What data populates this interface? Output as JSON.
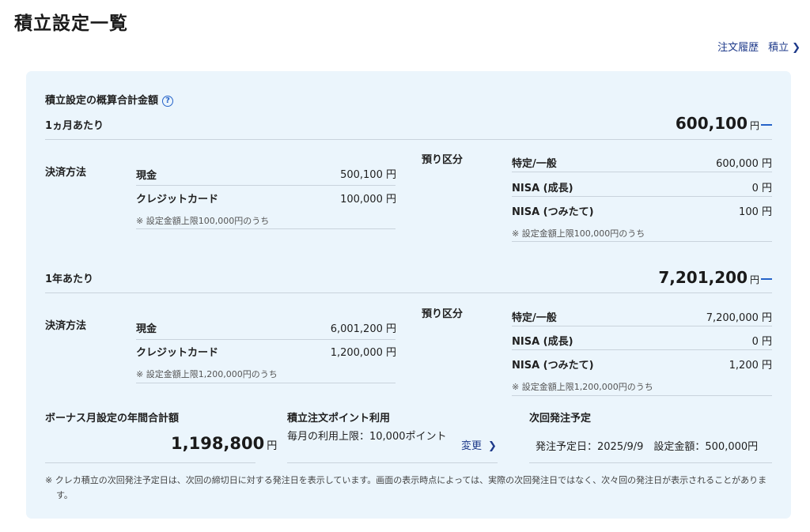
{
  "page": {
    "title": "積立設定一覧",
    "links": {
      "history": "注文履歴",
      "tsumitate": "積立"
    }
  },
  "summary": {
    "title": "積立設定の概算合計金額",
    "help_icon": "?"
  },
  "month": {
    "label": "1ヵ月あたり",
    "total": "600,100",
    "unit": "円",
    "payment_label": "決済方法",
    "cash_label": "現金",
    "cash_value": "500,100 円",
    "credit_label": "クレジットカード",
    "credit_value": "100,000 円",
    "credit_note": "※ 設定金額上限100,000円のうち",
    "account_label": "預り区分",
    "general_label": "特定/一般",
    "general_value": "600,000 円",
    "nisa_growth_label": "NISA (成長)",
    "nisa_growth_value": "0 円",
    "nisa_tsumi_label": "NISA (つみたて)",
    "nisa_tsumi_value": "100 円",
    "nisa_note": "※ 設定金額上限100,000円のうち"
  },
  "year": {
    "label": "1年あたり",
    "total": "7,201,200",
    "unit": "円",
    "payment_label": "決済方法",
    "cash_label": "現金",
    "cash_value": "6,001,200 円",
    "credit_label": "クレジットカード",
    "credit_value": "1,200,000 円",
    "credit_note": "※ 設定金額上限1,200,000円のうち",
    "account_label": "預り区分",
    "general_label": "特定/一般",
    "general_value": "7,200,000 円",
    "nisa_growth_label": "NISA (成長)",
    "nisa_growth_value": "0 円",
    "nisa_tsumi_label": "NISA (つみたて)",
    "nisa_tsumi_value": "1,200 円",
    "nisa_note": "※ 設定金額上限1,200,000円のうち"
  },
  "bonus": {
    "title": "ボーナス月設定の年間合計額",
    "value": "1,198,800",
    "unit": "円"
  },
  "points": {
    "title": "積立注文ポイント利用",
    "text": "毎月の利用上限：10,000ポイント",
    "change": "変更"
  },
  "next_order": {
    "title": "次回発注予定",
    "text": "発注予定日：2025/9/9　設定金額：500,000円"
  },
  "footnote": "※ クレカ積立の次回発注予定日は、次回の締切日に対する発注日を表示しています。画面の表示時点によっては、実際の次回発注日ではなく、次々回の発注日が表示されることがあります。",
  "colors": {
    "accent": "#2563c9",
    "link": "#1e3a8a",
    "panel_bg": "#ebf5fc"
  }
}
